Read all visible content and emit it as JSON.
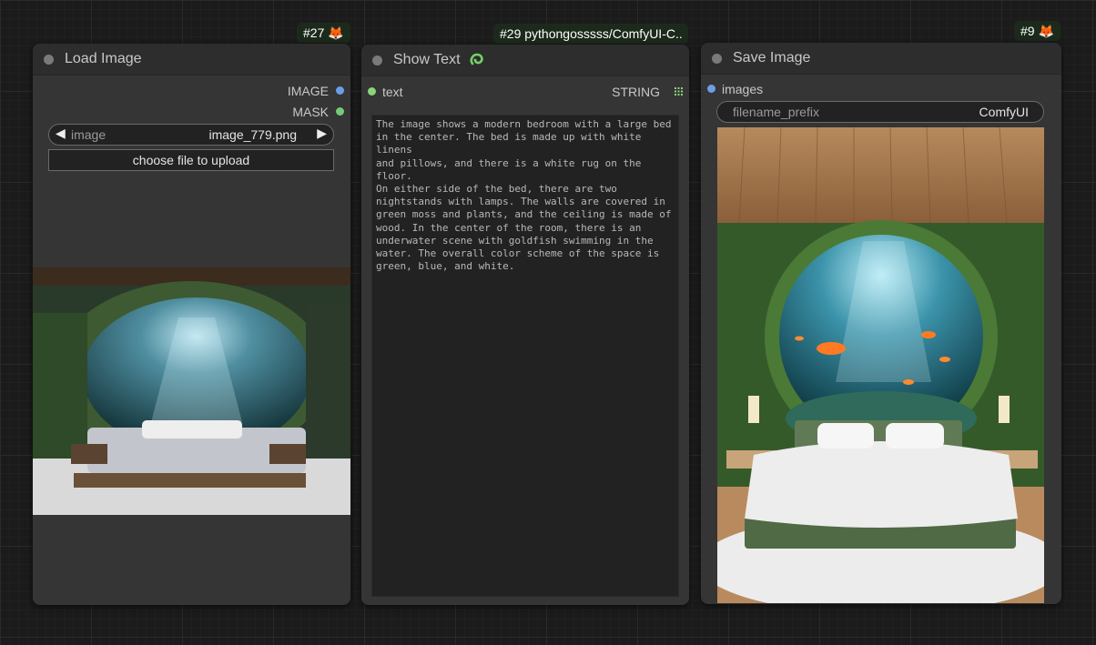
{
  "badges": {
    "load": "#27 🦊",
    "show": "#29 pythongosssss/ComfyUI-C..",
    "save": "#9 🦊"
  },
  "load_node": {
    "title": "Load Image",
    "outputs": [
      {
        "label": "IMAGE",
        "color": "#6b9ee8"
      },
      {
        "label": "MASK",
        "color": "#79c97b"
      }
    ],
    "image_widget": {
      "label": "image",
      "value": "image_779.png",
      "left_arrow": "◀",
      "right_arrow": "▶"
    },
    "upload_label": "choose file to upload"
  },
  "show_node": {
    "title": "Show Text",
    "input": {
      "label": "text",
      "color": "#8bd47a"
    },
    "output": {
      "label": "STRING"
    },
    "text": "The image shows a modern bedroom with a large bed\nin the center. The bed is made up with white linens\nand pillows, and there is a white rug on the floor.\nOn either side of the bed, there are two\nnightstands with lamps. The walls are covered in\ngreen moss and plants, and the ceiling is made of\nwood. In the center of the room, there is an\nunderwater scene with goldfish swimming in the\nwater. The overall color scheme of the space is\ngreen, blue, and white."
  },
  "save_node": {
    "title": "Save Image",
    "input": {
      "label": "images",
      "color": "#6b9ee8"
    },
    "prefix_widget": {
      "label": "filename_prefix",
      "value": "ComfyUI"
    }
  }
}
